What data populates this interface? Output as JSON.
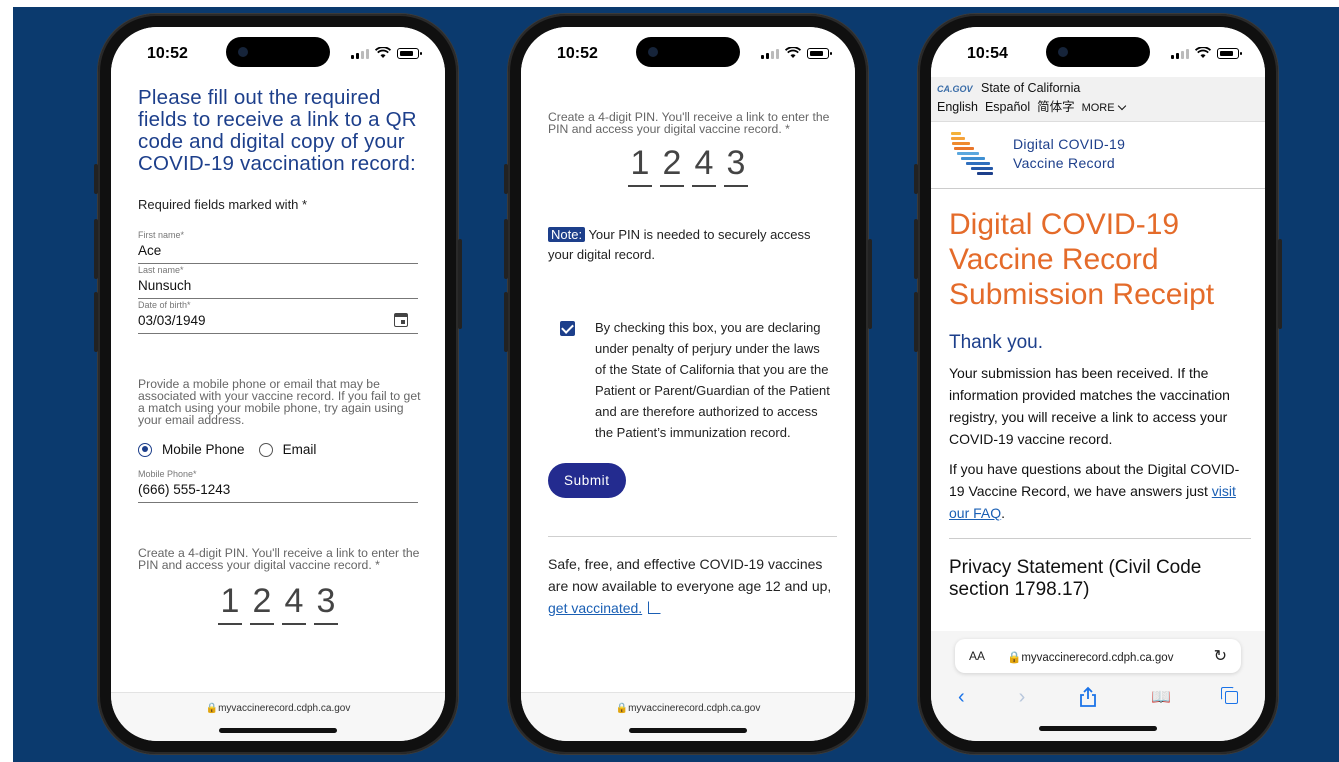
{
  "phone1": {
    "time": "10:52",
    "heading": "Please fill out the required fields to receive a link to a QR code and digital copy of your COVID-19 vaccination record:",
    "required_note": "Required fields marked with *",
    "fields": [
      {
        "label": "First name*",
        "value": "Ace"
      },
      {
        "label": "Last name*",
        "value": "Nunsuch"
      },
      {
        "label": "Date of birth*",
        "value": "03/03/1949"
      }
    ],
    "provide_text": "Provide a mobile phone or email that may be associated with your vaccine record. If you fail to get a match using your mobile phone, try again using your email address.",
    "radio_mobile": "Mobile Phone",
    "radio_email": "Email",
    "phone_label": "Mobile Phone*",
    "phone_value": "(666) 555-1243",
    "pin_text": "Create a 4-digit PIN. You'll receive a link to enter the PIN and access your digital vaccine record. *",
    "pin": [
      "1",
      "2",
      "4",
      "3"
    ],
    "url": "myvaccinerecord.cdph.ca.gov"
  },
  "phone2": {
    "time": "10:52",
    "pin_text": "Create a 4-digit PIN. You'll receive a link to enter the PIN and access your digital vaccine record. *",
    "pin": [
      "1",
      "2",
      "4",
      "3"
    ],
    "note_tag": "Note:",
    "note_text": " Your PIN is needed to securely access your digital record.",
    "consent_text": "By checking this box, you are declaring under penalty of perjury under the laws of the State of California that you are the Patient or Parent/Guardian of the Patient and are therefore authorized to access the Patient’s immunization record.",
    "submit_label": "Submit",
    "safe_text": "Safe, free, and effective COVID-19 vaccines are now available to everyone age 12 and up, ",
    "safe_link": "get vaccinated.",
    "url": "myvaccinerecord.cdph.ca.gov"
  },
  "phone3": {
    "time": "10:54",
    "gov_logo": "CA.GOV",
    "state": "State of California",
    "languages": [
      "English",
      "Español",
      "简体字"
    ],
    "more": "MORE",
    "brand_line1": "Digital COVID-19",
    "brand_line2": "Vaccine Record",
    "title": "Digital COVID-19 Vaccine Record Submission Receipt",
    "thanks": "Thank you.",
    "para1": "Your submission has been received. If the information provided matches the vaccination registry, you will receive a link to access your COVID-19 vaccine record.",
    "para2_text": "If you have questions about the Digital COVID-19 Vaccine Record, we have answers just ",
    "para2_link": "visit our FAQ",
    "para2_end": ".",
    "privacy": "Privacy Statement (Civil Code section 1798.17)",
    "aa": "AA",
    "url": "myvaccinerecord.cdph.ca.gov"
  }
}
